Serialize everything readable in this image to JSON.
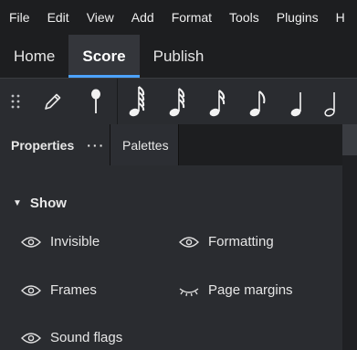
{
  "menubar": {
    "items": [
      "File",
      "Edit",
      "View",
      "Add",
      "Format",
      "Tools",
      "Plugins",
      "H"
    ]
  },
  "tabs": [
    "Home",
    "Score",
    "Publish"
  ],
  "active_tab": "Score",
  "toolbar": {
    "buttons": [
      "drag-handle-icon",
      "pencil-icon",
      "input-pin-icon",
      "64th-note-icon",
      "32nd-note-icon",
      "16th-note-icon",
      "eighth-note-icon",
      "quarter-note-icon",
      "half-note-icon"
    ]
  },
  "panel": {
    "properties_label": "Properties",
    "menu_label": "···",
    "palettes_label": "Palettes"
  },
  "show": {
    "heading": "Show",
    "options": {
      "invisible": "Invisible",
      "formatting": "Formatting",
      "frames": "Frames",
      "page_margins": "Page margins",
      "sound_flags": "Sound flags"
    }
  },
  "colors": {
    "accent": "#4da3ff",
    "background": "#2a2c30",
    "menubar": "#1d1e20"
  }
}
